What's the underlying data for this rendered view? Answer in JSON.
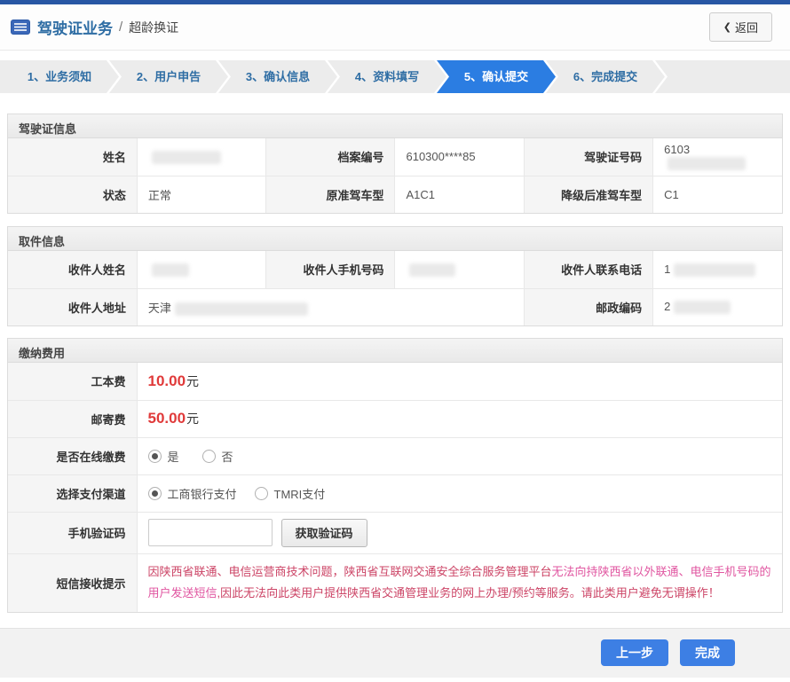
{
  "header": {
    "title": "驾驶证业务",
    "separator": "/",
    "subtitle": "超龄换证",
    "back_chevron": "❮",
    "back_label": "返回"
  },
  "steps": [
    {
      "label": "1、业务须知",
      "active": false
    },
    {
      "label": "2、用户申告",
      "active": false
    },
    {
      "label": "3、确认信息",
      "active": false
    },
    {
      "label": "4、资料填写",
      "active": false
    },
    {
      "label": "5、确认提交",
      "active": true
    },
    {
      "label": "6、完成提交",
      "active": false
    }
  ],
  "license": {
    "title": "驾驶证信息",
    "row1": {
      "l1": "姓名",
      "v1": "",
      "l2": "档案编号",
      "v2": "610300****85",
      "l3": "驾驶证号码",
      "v3": "6103"
    },
    "row2": {
      "l1": "状态",
      "v1": "正常",
      "l2": "原准驾车型",
      "v2": "A1C1",
      "l3": "降级后准驾车型",
      "v3": "C1"
    }
  },
  "pickup": {
    "title": "取件信息",
    "row1": {
      "l1": "收件人姓名",
      "v1": "",
      "l2": "收件人手机号码",
      "v2": "",
      "l3": "收件人联系电话",
      "v3": "1"
    },
    "row2": {
      "l1": "收件人地址",
      "v1": "天津",
      "l2": "邮政编码",
      "v2": "2"
    }
  },
  "fees": {
    "title": "缴纳费用",
    "cost_label": "工本费",
    "cost_amount": "10.00",
    "cost_unit": "元",
    "postage_label": "邮寄费",
    "postage_amount": "50.00",
    "postage_unit": "元",
    "online_label": "是否在线缴费",
    "online_yes": "是",
    "online_no": "否",
    "channel_label": "选择支付渠道",
    "channel_icbc": "工商银行支付",
    "channel_tmri": "TMRI支付",
    "code_label": "手机验证码",
    "code_value": "",
    "code_button": "获取验证码",
    "notice_label": "短信接收提示",
    "notice_part1": "因陕西省联通、电信运营商技术问题，陕西省互联网交通安全综合服务管理平台",
    "notice_part2": "无法向持陕西省以外联通、电信手机号码的用户发送短信",
    "notice_part3": ",因此无法向此类用户提供陕西省交通管理业务的网上办理/预约等服务。请此类用户避免无谓操作！"
  },
  "footer": {
    "prev_label": "上一步",
    "finish_label": "完成"
  },
  "colors": {
    "topbar_blue": "#2857a4",
    "accent_blue": "#2e6da4",
    "active_step_blue": "#2b7de2",
    "fee_red": "#e03a3a",
    "notice_red": "#cc4466",
    "notice_magenta": "#e055a0",
    "button_blue": "#3d7fe4"
  }
}
